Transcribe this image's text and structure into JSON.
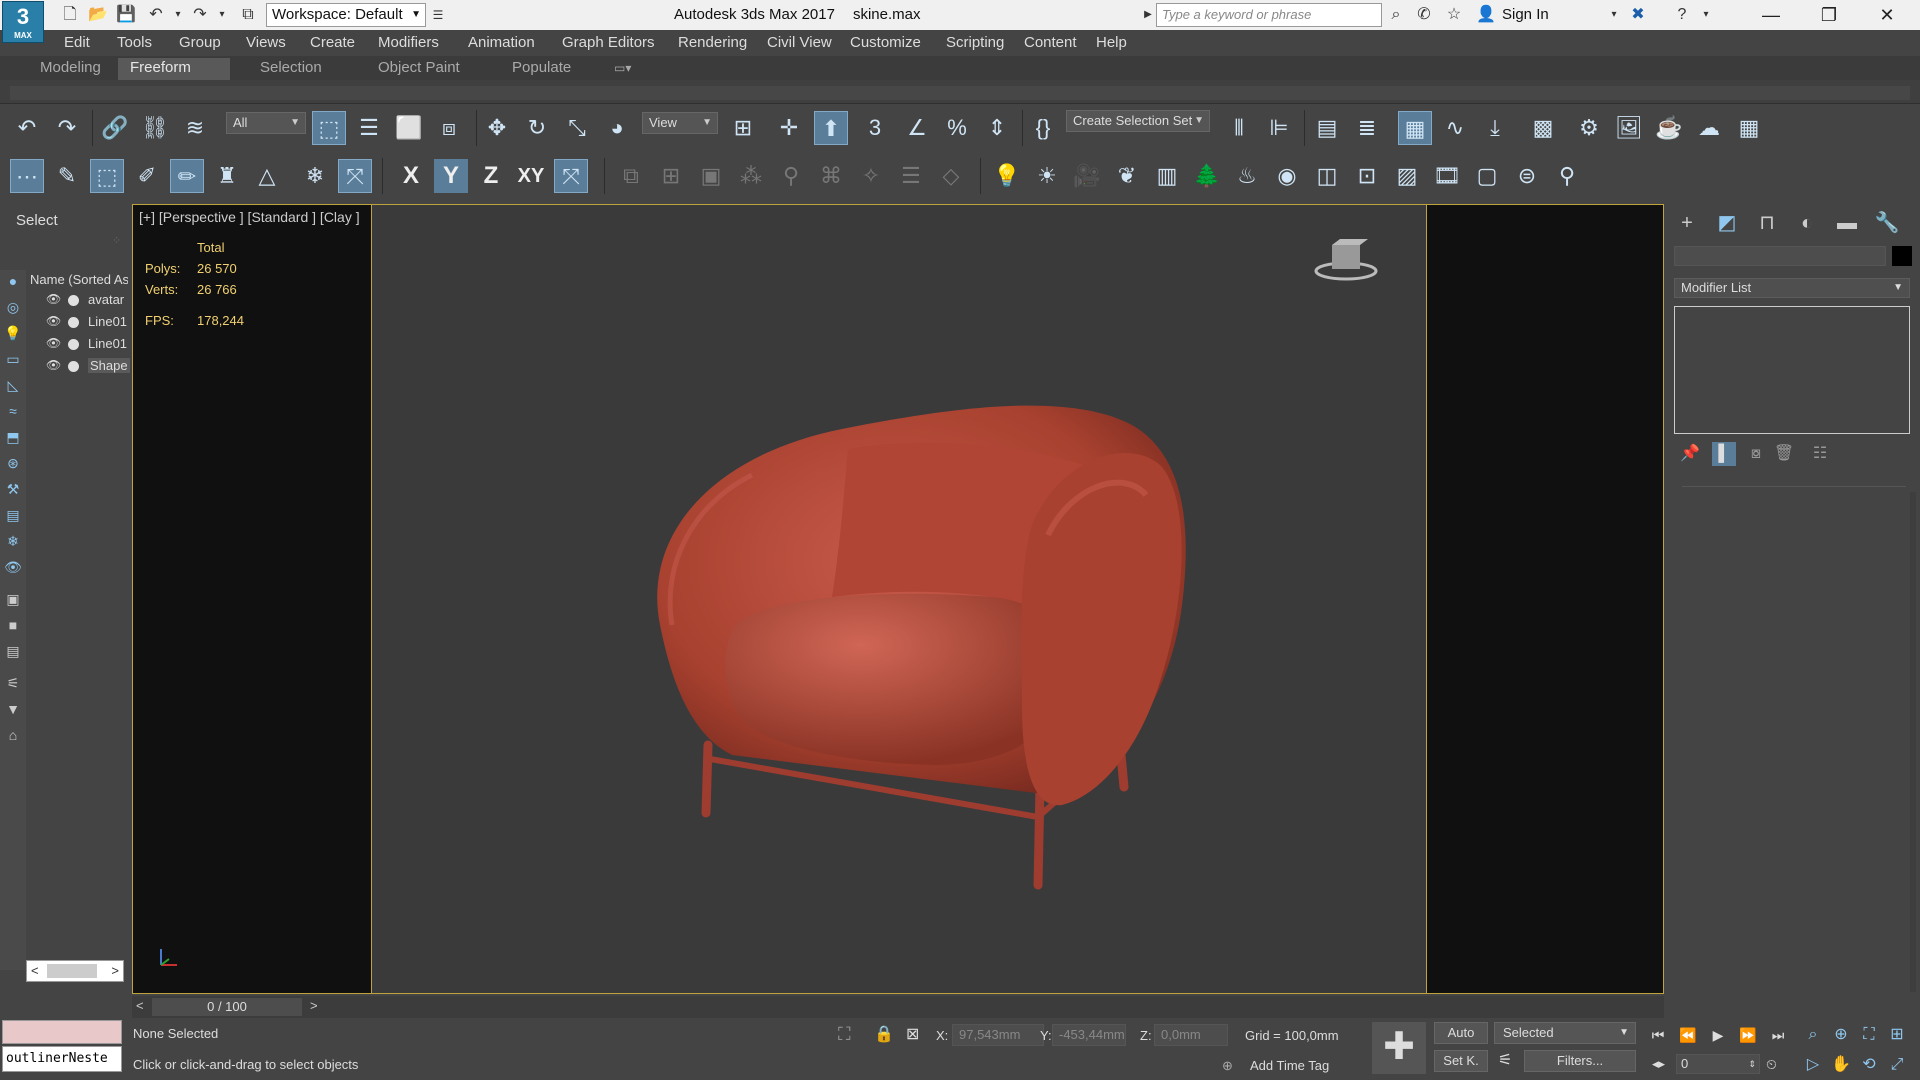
{
  "title_bar": {
    "logo_text": "3",
    "logo_sub": "MAX",
    "workspace": "Workspace: Default",
    "app_title": "Autodesk 3ds Max 2017",
    "file_name": "skine.max",
    "search_placeholder": "Type a keyword or phrase",
    "sign_in": "Sign In"
  },
  "menu": [
    "Edit",
    "Tools",
    "Group",
    "Views",
    "Create",
    "Modifiers",
    "Animation",
    "Graph Editors",
    "Rendering",
    "Civil View",
    "Customize",
    "Scripting",
    "Content",
    "Help"
  ],
  "ribbon_tabs": [
    {
      "label": "Modeling",
      "active": false
    },
    {
      "label": "Freeform",
      "active": true
    },
    {
      "label": "Selection",
      "active": false
    },
    {
      "label": "Object Paint",
      "active": false
    },
    {
      "label": "Populate",
      "active": false
    }
  ],
  "toolbar": {
    "selection_filter": "All",
    "reference_coord": "View",
    "selection_set": "Create Selection Set",
    "axis_x": "X",
    "axis_y": "Y",
    "axis_z": "Z",
    "axis_xy": "XY"
  },
  "left_panel": {
    "select_label": "Select",
    "list_header": "Name (Sorted As",
    "items": [
      {
        "name": "avatar"
      },
      {
        "name": "Line01"
      },
      {
        "name": "Line01"
      },
      {
        "name": "Shape"
      }
    ]
  },
  "viewport": {
    "label": "[+] [Perspective ] [Standard ] [Clay ]",
    "stats_header": "Total",
    "polys_label": "Polys:",
    "polys_value": "26 570",
    "verts_label": "Verts:",
    "verts_value": "26 766",
    "fps_label": "FPS:",
    "fps_value": "178,244",
    "object_color": "#b5463a"
  },
  "timeline": {
    "frame_text": "0 / 100",
    "prev": "<",
    "next": ">"
  },
  "right_panel": {
    "modifier_list": "Modifier List"
  },
  "status": {
    "listener_text": "outlinerNeste",
    "selection_status": "None Selected",
    "prompt": "Click or click-and-drag to select objects",
    "x_label": "X:",
    "x_value": "97,543mm",
    "y_label": "Y:",
    "y_value": "-453,44mm",
    "z_label": "Z:",
    "z_value": "0,0mm",
    "grid": "Grid = 100,0mm",
    "add_time_tag": "Add Time Tag",
    "auto": "Auto",
    "selected": "Selected",
    "set_key": "Set K.",
    "filters": "Filters...",
    "current_frame": "0"
  }
}
